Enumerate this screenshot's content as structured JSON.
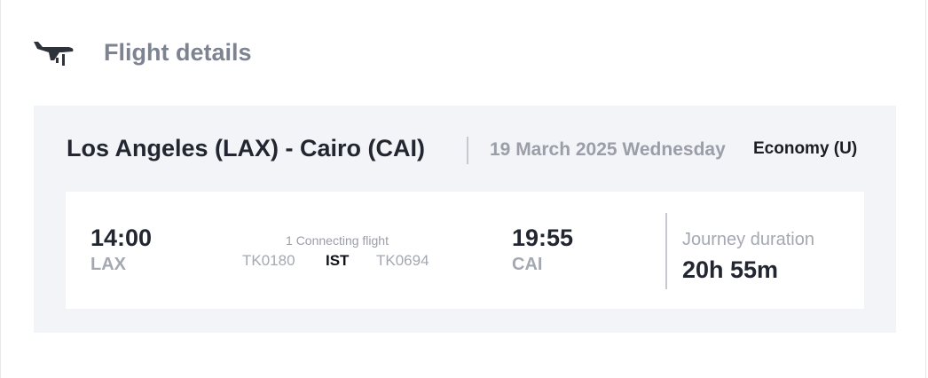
{
  "header": {
    "icon": "airplane-icon",
    "title": "Flight details"
  },
  "summary": {
    "route": "Los Angeles (LAX) - Cairo (CAI)",
    "date": "19 March 2025 Wednesday",
    "cabin": "Economy (U)"
  },
  "itinerary": {
    "departure": {
      "time": "14:00",
      "airport": "LAX"
    },
    "connection": {
      "label": "1 Connecting flight",
      "flights": [
        "TK0180",
        "TK0694"
      ],
      "via": "IST"
    },
    "arrival": {
      "time": "19:55",
      "airport": "CAI"
    },
    "journey": {
      "label": "Journey duration",
      "value": "20h 55m"
    }
  },
  "colors": {
    "card_bg": "#f3f4f7",
    "title_gray": "#7d8390",
    "text_dark": "#222630"
  }
}
